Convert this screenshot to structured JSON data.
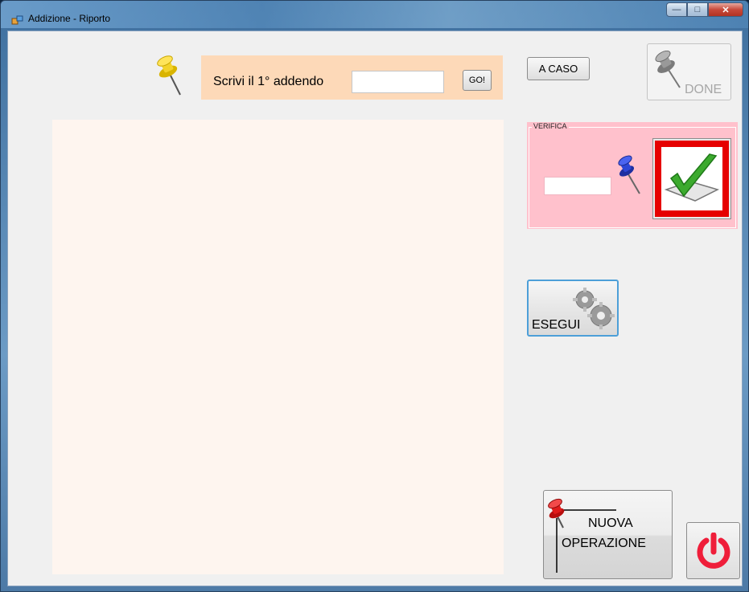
{
  "window": {
    "title": "Addizione - Riporto",
    "caption_buttons": [
      "minimize",
      "maximize",
      "close"
    ]
  },
  "input_panel": {
    "prompt": "Scrivi il 1° addendo",
    "addend_value": "",
    "go_label": "GO!",
    "background": "#fdd9b8"
  },
  "toolbar": {
    "random_label": "A CASO",
    "done_label": "DONE"
  },
  "work_area": {
    "background": "#fef5ef"
  },
  "verifica": {
    "legend": "VERIFICA",
    "answer_value": "",
    "background": "#ffc1cc",
    "check_icon": "green-check-icon"
  },
  "actions": {
    "execute_label": "ESEGUI",
    "new_operation_line1": "NUOVA",
    "new_operation_line2": "OPERAZIONE",
    "power_icon": "power-icon"
  },
  "icons": {
    "yellow_pin": "yellow-pushpin-icon",
    "gray_pin": "gray-pushpin-icon",
    "blue_pin": "blue-pushpin-icon",
    "red_pin": "red-pushpin-icon",
    "gears": "gears-icon"
  },
  "colors": {
    "power_red": "#ef1e3a",
    "check_border": "#e60000",
    "check_green": "#3caa2e"
  }
}
